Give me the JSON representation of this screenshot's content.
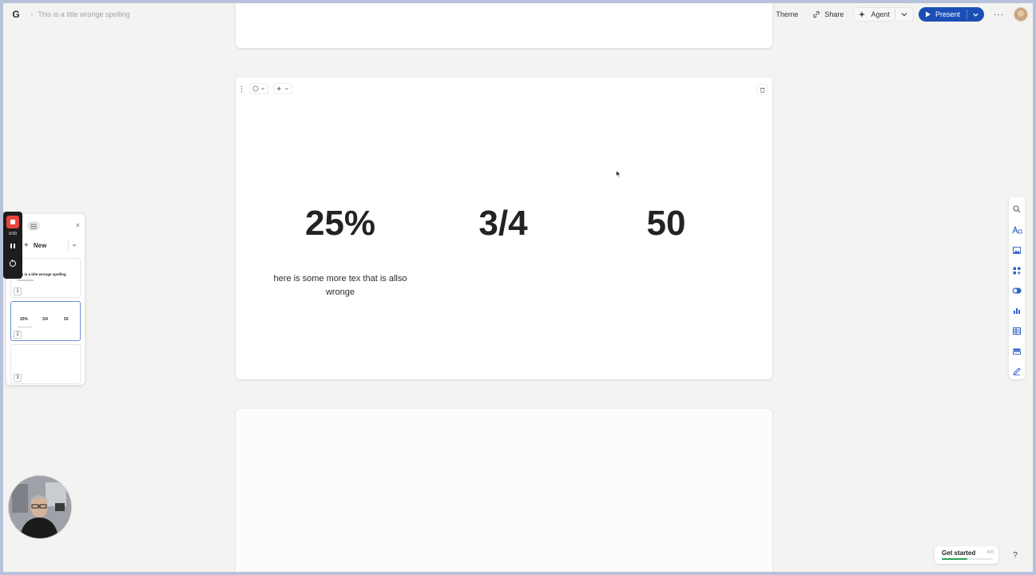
{
  "app": {
    "logo_letter": "G",
    "doc_title": "This is a title wronge spelling"
  },
  "toolbar": {
    "theme_label": "Theme",
    "share_label": "Share",
    "agent_label": "Agent",
    "present_label": "Present",
    "more_label": "···"
  },
  "slide": {
    "stats": [
      "25%",
      "3/4",
      "50"
    ],
    "description": "here is some more tex that is allso wronge"
  },
  "panel": {
    "new_label": "New",
    "close_label": "×",
    "thumbs": [
      {
        "number": "1",
        "title": "This is a title wronge spelling"
      },
      {
        "number": "2",
        "stats": [
          "25%",
          "3/4",
          "50"
        ]
      },
      {
        "number": "3"
      }
    ]
  },
  "recorder": {
    "time": "0:00"
  },
  "get_started": {
    "label": "Get started",
    "count": "4/8",
    "progress_fraction": 0.5
  },
  "help_label": "?",
  "colors": {
    "accent": "#1c4fb6",
    "record": "#e8453c",
    "progress": "#2aa45a"
  },
  "icons": [
    "palette-icon",
    "link-icon",
    "sparkle-icon",
    "play-icon",
    "search-icon",
    "text-style-icon",
    "image-icon",
    "add-block-icon",
    "toggle-icon",
    "chart-icon",
    "table-icon",
    "layout-icon",
    "edit-icon"
  ]
}
